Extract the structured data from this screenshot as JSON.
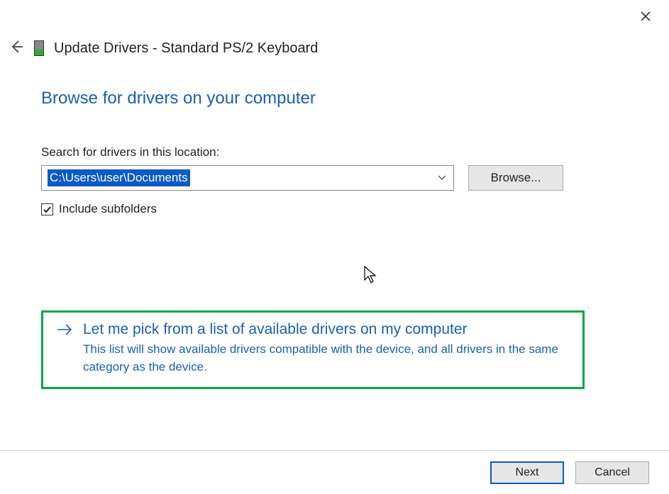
{
  "header": {
    "title": "Update Drivers - Standard PS/2 Keyboard"
  },
  "page": {
    "heading": "Browse for drivers on your computer",
    "search_label": "Search for drivers in this location:",
    "path_value": "C:\\Users\\user\\Documents",
    "browse_button": "Browse...",
    "include_subfolders_label": "Include subfolders",
    "include_subfolders_checked": true
  },
  "option": {
    "title": "Let me pick from a list of available drivers on my computer",
    "description": "This list will show available drivers compatible with the device, and all drivers in the same category as the device."
  },
  "footer": {
    "next": "Next",
    "cancel": "Cancel"
  }
}
